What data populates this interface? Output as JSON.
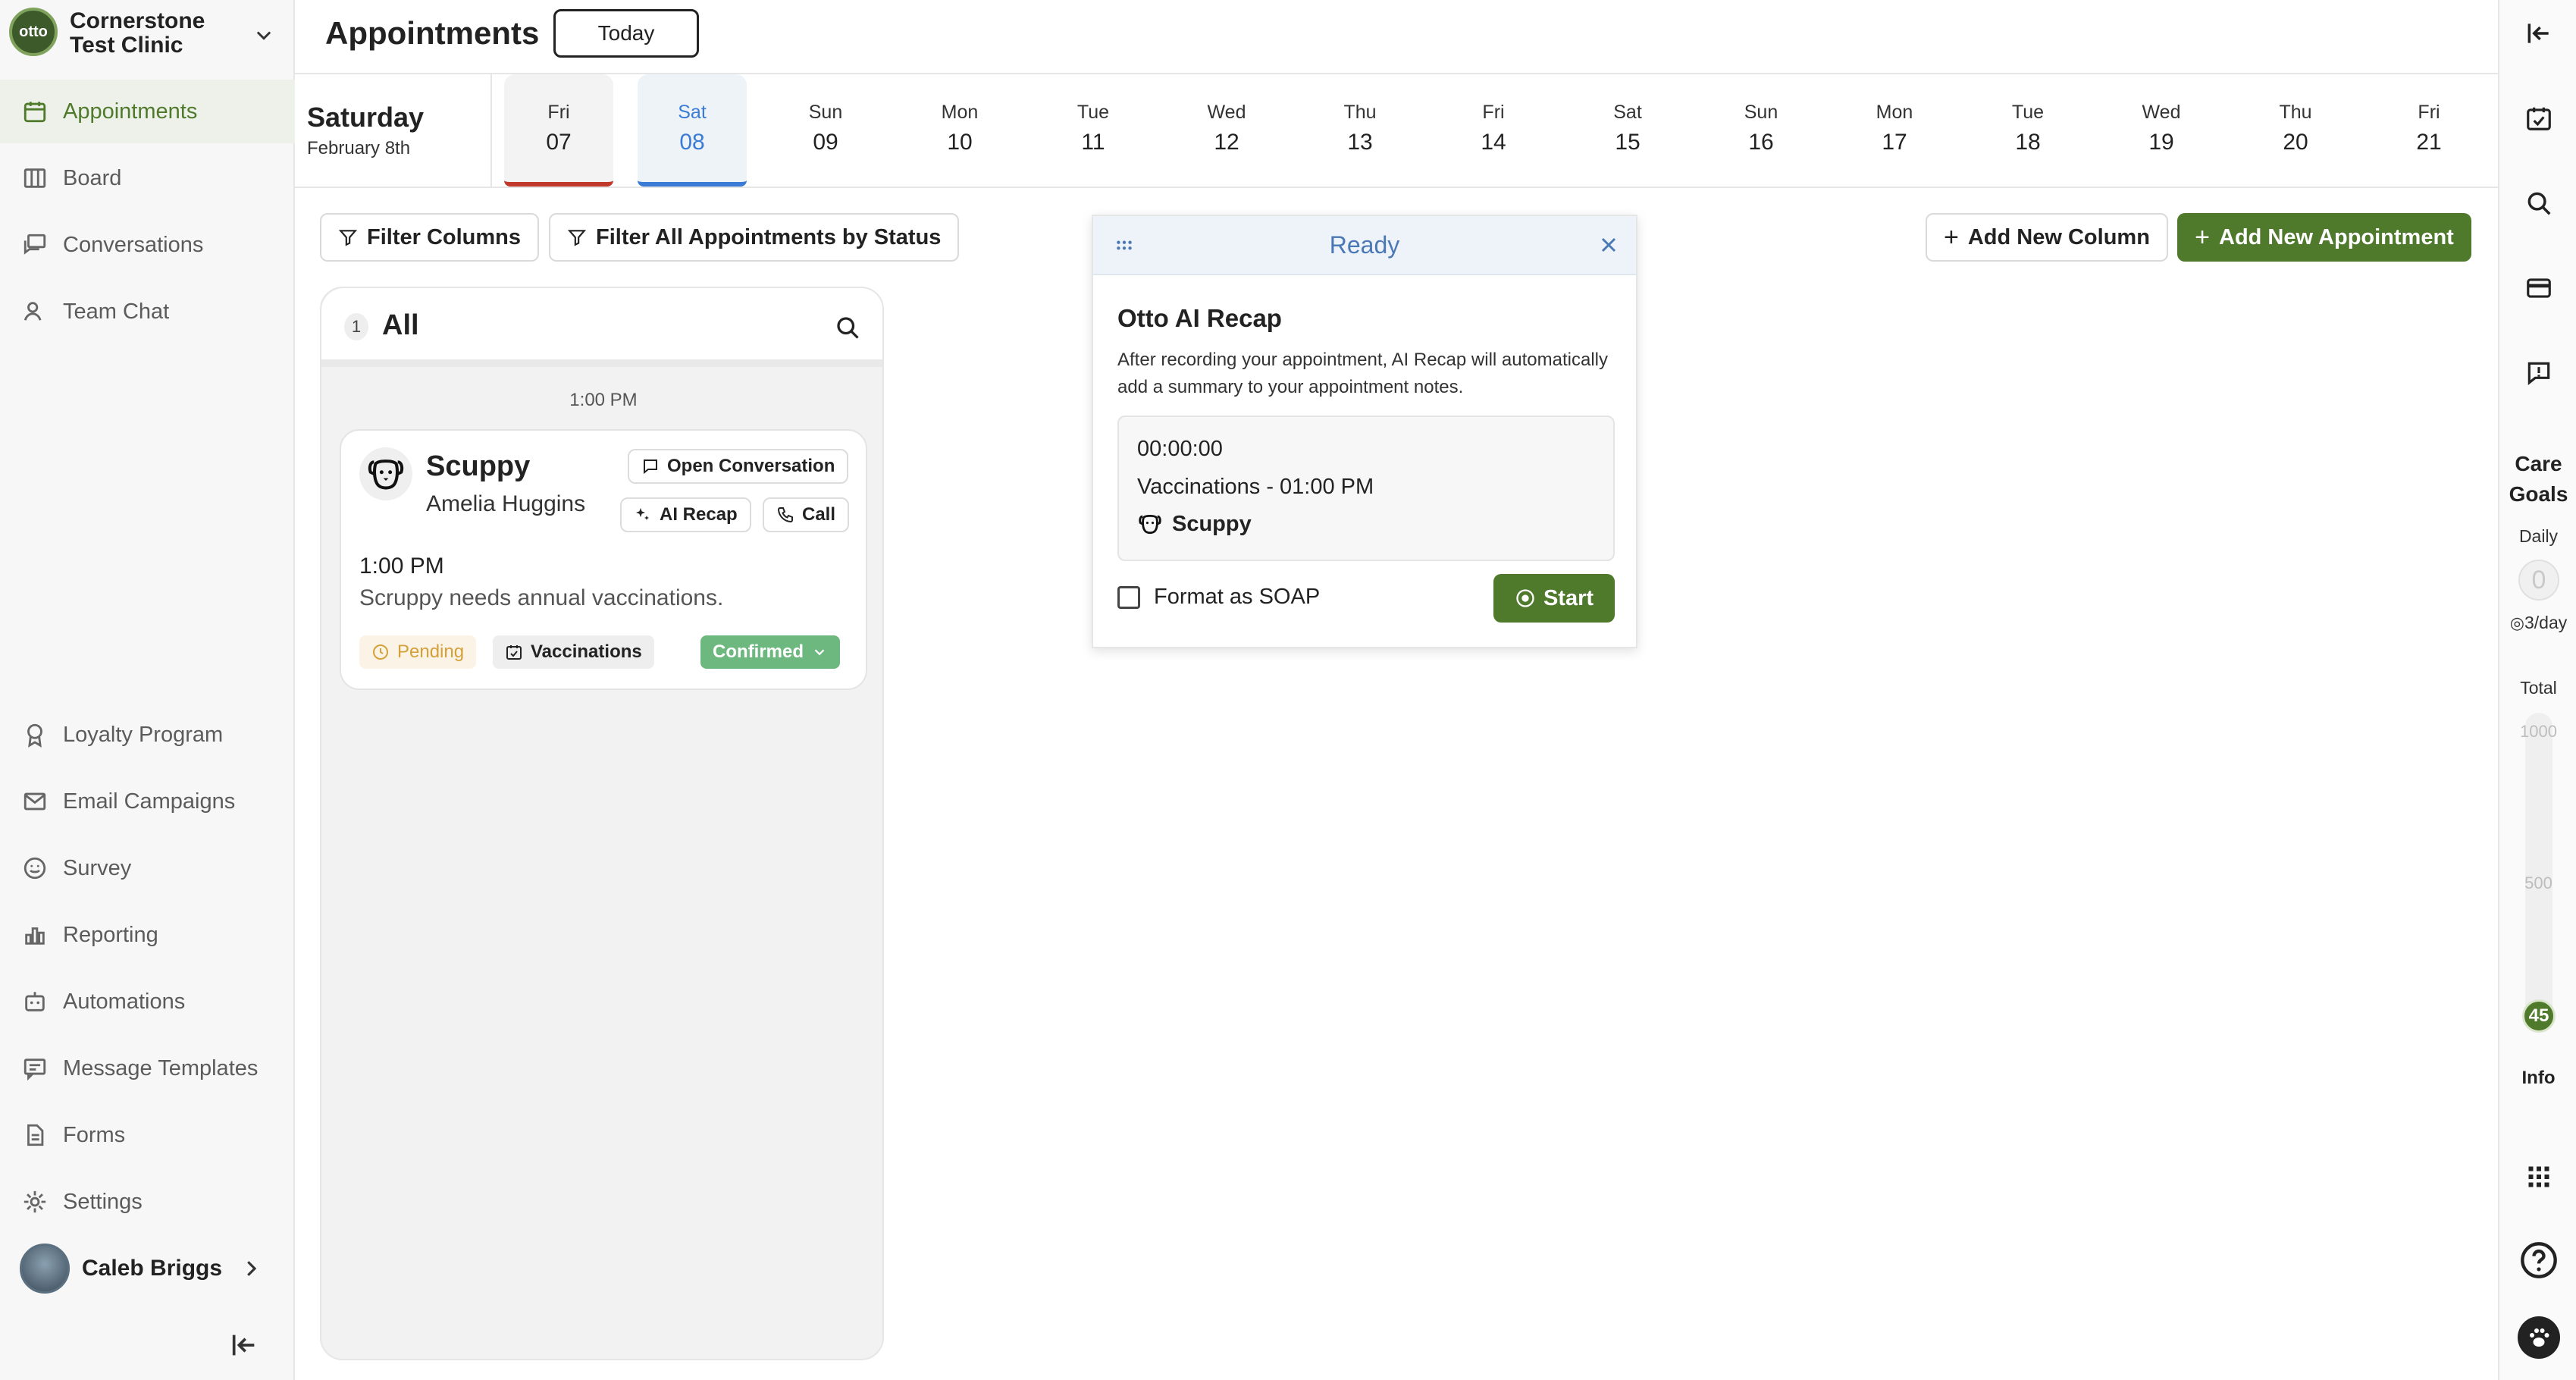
{
  "clinic": {
    "logo_text": "otto",
    "name": "Cornerstone Test Clinic"
  },
  "nav": {
    "top": [
      {
        "label": "Appointments",
        "icon": "calendar-icon",
        "active": true
      },
      {
        "label": "Board",
        "icon": "board-icon"
      },
      {
        "label": "Conversations",
        "icon": "chat-icon"
      },
      {
        "label": "Team Chat",
        "icon": "team-icon"
      }
    ],
    "bottom": [
      {
        "label": "Loyalty Program",
        "icon": "award-icon"
      },
      {
        "label": "Email Campaigns",
        "icon": "mail-icon"
      },
      {
        "label": "Survey",
        "icon": "smile-icon"
      },
      {
        "label": "Reporting",
        "icon": "bar-chart-icon"
      },
      {
        "label": "Automations",
        "icon": "robot-icon"
      },
      {
        "label": "Message Templates",
        "icon": "template-icon"
      },
      {
        "label": "Forms",
        "icon": "document-icon"
      },
      {
        "label": "Settings",
        "icon": "gear-icon"
      }
    ]
  },
  "user": {
    "name": "Caleb Briggs"
  },
  "header": {
    "title": "Appointments",
    "today_label": "Today"
  },
  "current_date": {
    "weekday": "Saturday",
    "date": "February 8th"
  },
  "days": [
    {
      "dn": "Fri",
      "dd": "07",
      "state": "past"
    },
    {
      "dn": "Sat",
      "dd": "08",
      "state": "selected"
    },
    {
      "dn": "Sun",
      "dd": "09"
    },
    {
      "dn": "Mon",
      "dd": "10"
    },
    {
      "dn": "Tue",
      "dd": "11"
    },
    {
      "dn": "Wed",
      "dd": "12"
    },
    {
      "dn": "Thu",
      "dd": "13"
    },
    {
      "dn": "Fri",
      "dd": "14"
    },
    {
      "dn": "Sat",
      "dd": "15"
    },
    {
      "dn": "Sun",
      "dd": "16"
    },
    {
      "dn": "Mon",
      "dd": "17"
    },
    {
      "dn": "Tue",
      "dd": "18"
    },
    {
      "dn": "Wed",
      "dd": "19"
    },
    {
      "dn": "Thu",
      "dd": "20"
    },
    {
      "dn": "Fri",
      "dd": "21"
    }
  ],
  "toolbar": {
    "filter_columns": "Filter Columns",
    "filter_status": "Filter All Appointments by Status",
    "add_column": "Add New Column",
    "add_appointment": "Add New Appointment"
  },
  "column": {
    "count": "1",
    "title": "All",
    "time_label": "1:00 PM"
  },
  "appointment": {
    "patient": "Scuppy",
    "owner": "Amelia Huggins",
    "open_conversation": "Open Conversation",
    "ai_recap": "AI Recap",
    "call": "Call",
    "time": "1:00 PM",
    "note": "Scruppy needs annual vaccinations.",
    "status": "Pending",
    "type": "Vaccinations",
    "confirmation": "Confirmed"
  },
  "recap_panel": {
    "header": "Ready",
    "title": "Otto AI Recap",
    "description": "After recording your appointment, AI Recap will automatically add a summary to your appointment notes.",
    "timer": "00:00:00",
    "appointment": "Vaccinations - 01:00 PM",
    "patient": "Scuppy",
    "soap_label": "Format as SOAP",
    "start_label": "Start"
  },
  "care_goals": {
    "title": "Care Goals",
    "daily_label": "Daily",
    "daily_value": "0",
    "daily_target": "3/day",
    "total_label": "Total",
    "tick_max": "1000",
    "tick_mid": "500",
    "total_value": "45",
    "info_label": "Info"
  },
  "colors": {
    "accent": "#4f7a2b",
    "selected_day": "#3a7bd5",
    "past_day": "#c0392b",
    "confirmed": "#6db87f",
    "pending": "#d4a03a"
  }
}
